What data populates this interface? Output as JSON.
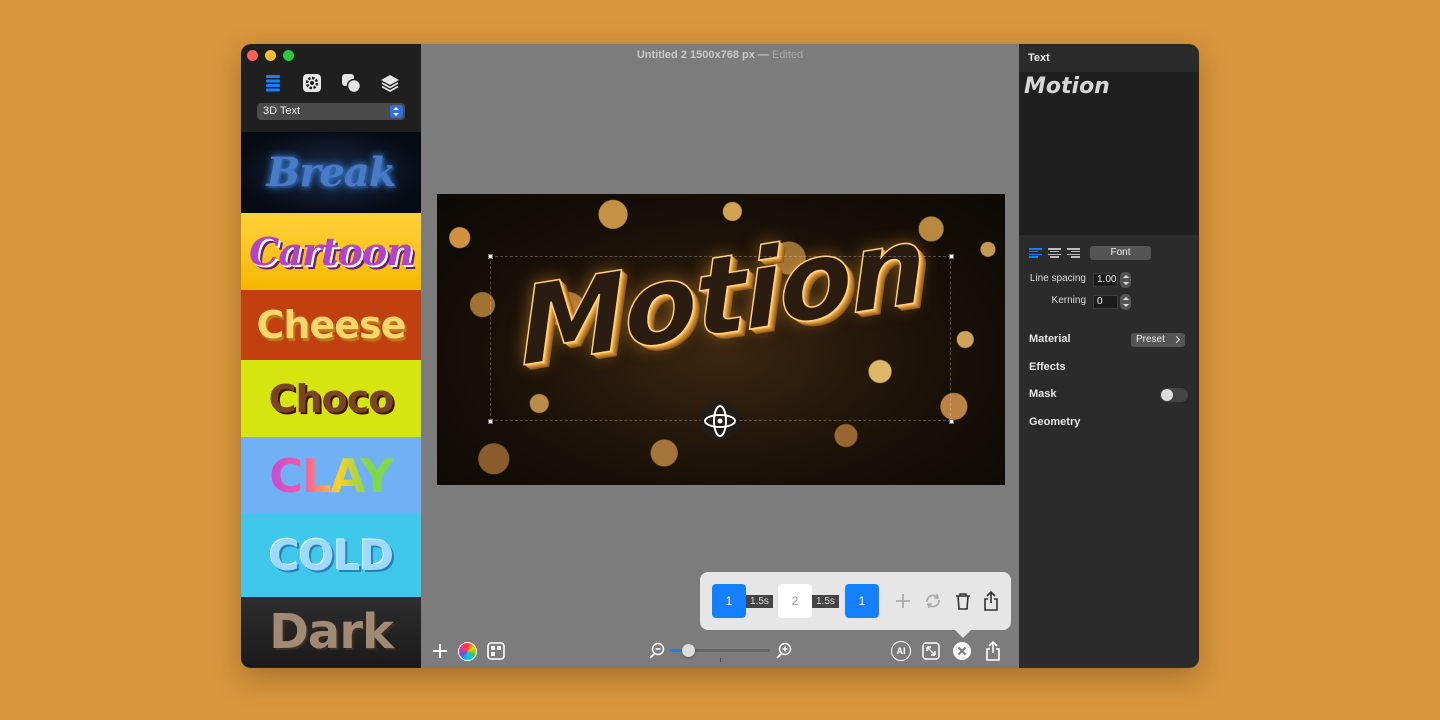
{
  "window": {
    "title": "Untitled 2 1500x768 px",
    "separator": "—",
    "status": "Edited"
  },
  "sidebar": {
    "tools": [
      "list-icon",
      "gear-icon",
      "shapes-icon",
      "layers-icon"
    ],
    "category": "3D Text",
    "styles": [
      "Break",
      "Cartoon",
      "Cheese",
      "Choco",
      "CLAY",
      "COLD",
      "Dark"
    ]
  },
  "canvas": {
    "text": "Motion"
  },
  "timeline": {
    "keyframes": [
      "1",
      "2",
      "1"
    ],
    "durations": [
      "1.5s",
      "1.5s"
    ]
  },
  "inspector": {
    "header": "Text",
    "preview_text": "Motion",
    "font_button": "Font",
    "line_spacing_label": "Line spacing",
    "line_spacing_value": "1.00",
    "kerning_label": "Kerning",
    "kerning_value": "0",
    "material_label": "Material",
    "preset_label": "Preset",
    "effects_label": "Effects",
    "mask_label": "Mask",
    "geometry_label": "Geometry",
    "mask_enabled": false
  },
  "bottom_toolbar": {
    "zoom_level": 0.18,
    "ai_label": "AI"
  },
  "colors": {
    "accent": "#1580ff",
    "background": "#D9963C"
  }
}
